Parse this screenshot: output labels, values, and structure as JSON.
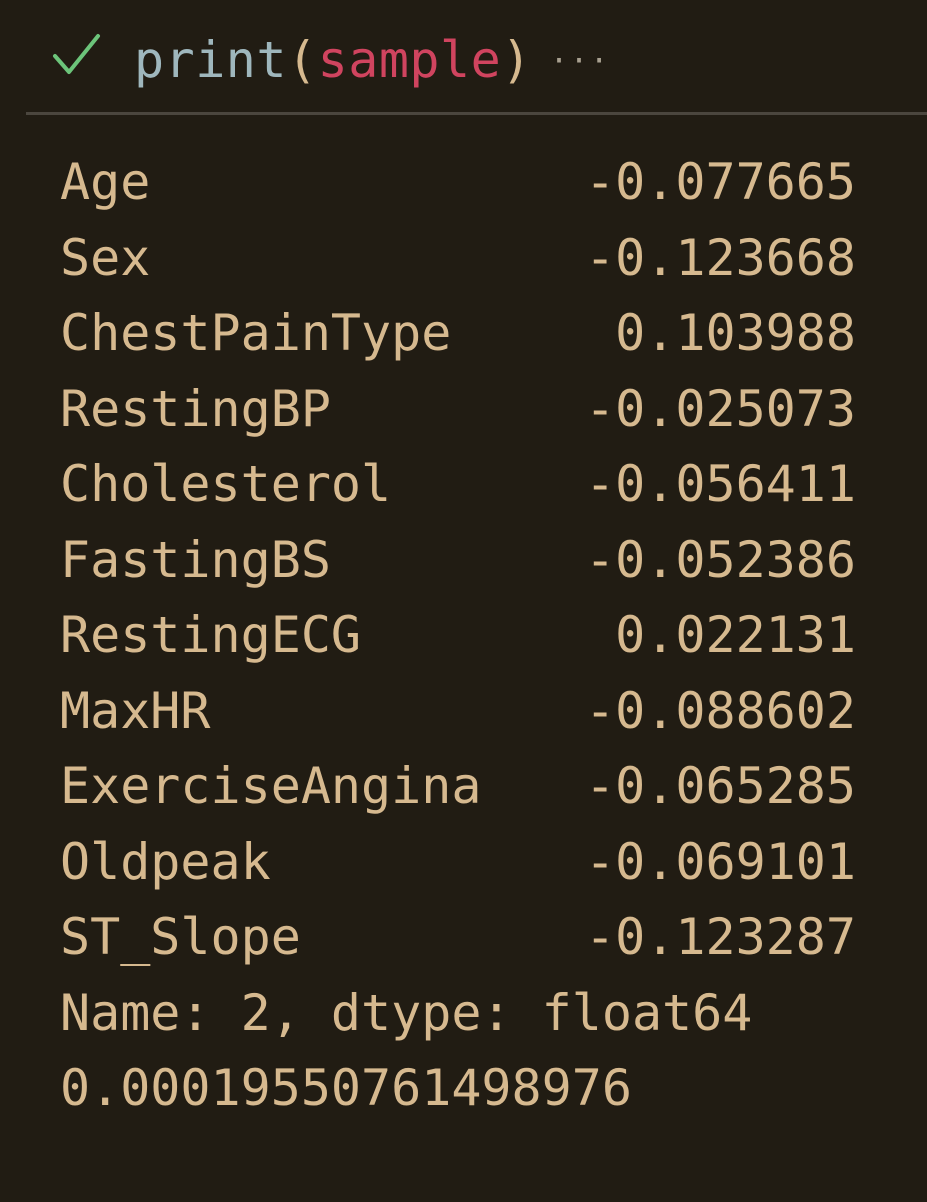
{
  "cell": {
    "status": "success",
    "status_icon": "checkmark-icon",
    "code": {
      "function": "print",
      "open_paren": "(",
      "argument": "sample",
      "close_paren": ")"
    },
    "more_icon": "ellipsis-icon",
    "more_label": "···"
  },
  "output": {
    "series": [
      {
        "name": "Age",
        "value": "-0.077665"
      },
      {
        "name": "Sex",
        "value": "-0.123668"
      },
      {
        "name": "ChestPainType",
        "value": "0.103988"
      },
      {
        "name": "RestingBP",
        "value": "-0.025073"
      },
      {
        "name": "Cholesterol",
        "value": "-0.056411"
      },
      {
        "name": "FastingBS",
        "value": "-0.052386"
      },
      {
        "name": "RestingECG",
        "value": "0.022131"
      },
      {
        "name": "MaxHR",
        "value": "-0.088602"
      },
      {
        "name": "ExerciseAngina",
        "value": "-0.065285"
      },
      {
        "name": "Oldpeak",
        "value": "-0.069101"
      },
      {
        "name": "ST_Slope",
        "value": "-0.123287"
      }
    ],
    "footer": "Name: 2, dtype: float64",
    "extra_line": "0.00019550761498976"
  },
  "colors": {
    "background": "#211c13",
    "check": "#6cc47a",
    "function": "#9fb7bd",
    "variable": "#d0445f",
    "text": "#d6b98f",
    "divider": "#4b463e"
  }
}
